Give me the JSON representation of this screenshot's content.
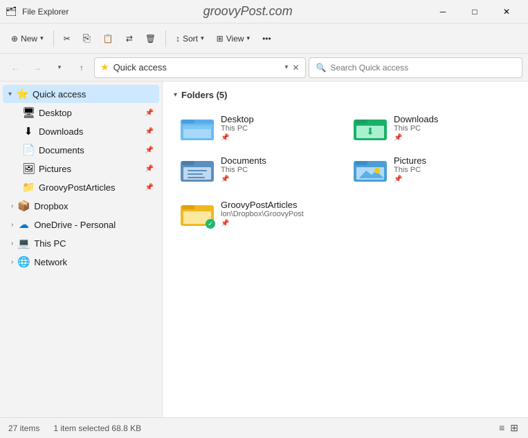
{
  "titleBar": {
    "icon": "🗂",
    "title": "File Explorer",
    "centerText": "groovyPost.com",
    "minimizeLabel": "─",
    "maximizeLabel": "□",
    "closeLabel": "✕"
  },
  "toolbar": {
    "newLabel": "New",
    "cutLabel": "✂",
    "copyLabel": "⎘",
    "pasteLabel": "📋",
    "moveLabel": "↔",
    "deleteLabel": "🗑",
    "sortLabel": "Sort",
    "viewLabel": "View",
    "moreLabel": "•••"
  },
  "addressBar": {
    "backLabel": "←",
    "forwardLabel": "→",
    "dropdownLabel": "˅",
    "upLabel": "↑",
    "currentPath": "Quick access",
    "searchPlaceholder": "Search Quick access"
  },
  "sidebar": {
    "quickAccessLabel": "Quick access",
    "items": [
      {
        "name": "Desktop",
        "icon": "🖥",
        "pinned": true
      },
      {
        "name": "Downloads",
        "icon": "⬇",
        "pinned": true
      },
      {
        "name": "Documents",
        "icon": "📄",
        "pinned": true
      },
      {
        "name": "Pictures",
        "icon": "🖼",
        "pinned": true
      },
      {
        "name": "GroovyPostArticles",
        "icon": "📁",
        "pinned": true
      }
    ],
    "navItems": [
      {
        "name": "Dropbox",
        "icon": "📦"
      },
      {
        "name": "OneDrive - Personal",
        "icon": "☁"
      },
      {
        "name": "This PC",
        "icon": "💻"
      },
      {
        "name": "Network",
        "icon": "🌐"
      }
    ]
  },
  "content": {
    "foldersHeader": "Folders (5)",
    "folders": [
      {
        "name": "Desktop",
        "path": "This PC",
        "type": "desktop",
        "color": "#4a9edd"
      },
      {
        "name": "Downloads",
        "path": "This PC",
        "type": "downloads",
        "color": "#20b86e"
      },
      {
        "name": "Documents",
        "path": "This PC",
        "type": "documents",
        "color": "#5a9fd6"
      },
      {
        "name": "Pictures",
        "path": "This PC",
        "type": "pictures",
        "color": "#5ab4f0"
      },
      {
        "name": "GroovyPostArticles",
        "path": "lon\\Dropbox\\GroovyPost",
        "type": "folder",
        "color": "#f5c518",
        "synced": true
      }
    ]
  },
  "statusBar": {
    "itemCount": "27 items",
    "selectedInfo": "1 item selected  68.8 KB"
  }
}
